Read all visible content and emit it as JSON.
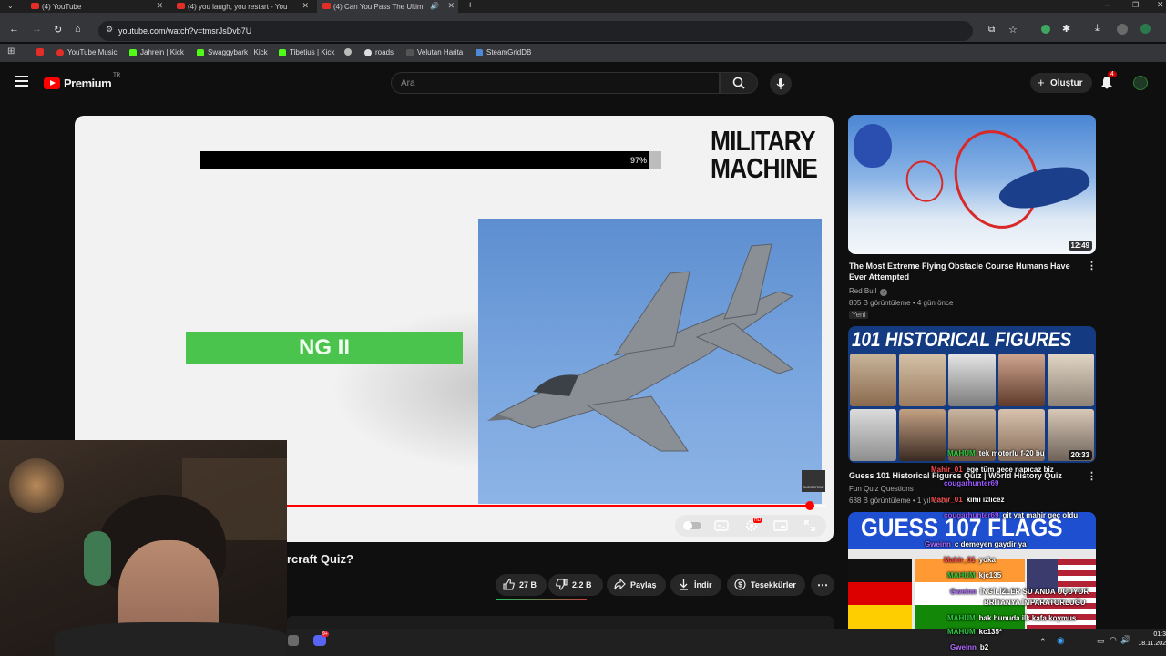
{
  "browser": {
    "tabs": [
      {
        "title": "(4) YouTube",
        "active": false
      },
      {
        "title": "(4) you laugh, you restart - You",
        "active": false
      },
      {
        "title": "(4) Can You Pass The Ultim",
        "active": true
      }
    ],
    "url": "youtube.com/watch?v=tmsrJsDvb7U",
    "bookmarks": [
      "YouTube Music",
      "Jahrein | Kick",
      "Swaggybark | Kick",
      "Tibetius | Kick",
      "roads",
      "Velutan Harita",
      "SteamGridDB"
    ]
  },
  "youtube": {
    "logo_text": "Premium",
    "logo_region": "TR",
    "search_placeholder": "Ara",
    "create_label": "Oluştur",
    "notification_count": "4"
  },
  "player": {
    "quiz_progress_label": "97%",
    "quiz_progress": 0.97,
    "category_line1": "MILITARY",
    "category_line2": "MACHINE",
    "answer_text": "NG II",
    "subscribe_label": "SUBSCRIBE",
    "hd_badge": "HD",
    "playback_progress": 0.97
  },
  "video": {
    "title_visible": "rcraft Quiz?",
    "actions": {
      "likes": "27 B",
      "dislikes": "2,2 B",
      "share": "Paylaş",
      "download": "İndir",
      "thanks": "Teşekkürler"
    }
  },
  "related": [
    {
      "title": "The Most Extreme Flying Obstacle Course Humans Have Ever Attempted",
      "channel": "Red Bull",
      "meta": "805 B görüntüleme • 4 gün önce",
      "badge": "Yeni",
      "duration": "12:49"
    },
    {
      "thumb_text": "101 HISTORICAL FIGURES",
      "title": "Guess 101 Historical Figures Quiz | World History Quiz",
      "channel": "Fun Quiz Questions",
      "meta": "688 B görüntüleme • 1 yıl önce",
      "duration": "20:33"
    },
    {
      "thumb_text": "GUESS 107 FLAGS"
    }
  ],
  "chat": [
    {
      "user": "MAHUM",
      "msg": "tek motorlu f-20 bu",
      "color": "#2ecc40"
    },
    {
      "user": "Mahir_01",
      "msg": "ege tüm gece napıcaz biz",
      "color": "#ff4d4d"
    },
    {
      "user": "cougarhunter69",
      "msg": "",
      "color": "#9b59ff"
    },
    {
      "user": "Mahir_01",
      "msg": "kimi izlicez",
      "color": "#ff4d4d"
    },
    {
      "user": "cougarhunter69",
      "msg": "git yat mahir geç oldu",
      "color": "#9b59ff"
    },
    {
      "user": "Gweinn",
      "msg": "c demeyen gaydir ya",
      "color": "#b06cff"
    },
    {
      "user": "Mahir_01",
      "msg": "yoka",
      "color": "#ff4d4d"
    },
    {
      "user": "MAHUM",
      "msg": "kjc135",
      "color": "#2ecc40"
    },
    {
      "user": "Gweinn",
      "msg": "İNGİLİZLER ŞU ANDA UÇUYOR",
      "color": "#b06cff"
    },
    {
      "user": "",
      "msg": "BRİTANYA İMPARATORLUĞU",
      "color": "#b06cff"
    },
    {
      "user": "MAHUM",
      "msg": "bak bunuda ilk kafa koymus",
      "color": "#2ecc40"
    },
    {
      "user": "MAHUM",
      "msg": "kc135*",
      "color": "#2ecc40"
    },
    {
      "user": "Gweinn",
      "msg": "b2",
      "color": "#b06cff"
    }
  ],
  "taskbar": {
    "time": "01:3",
    "date": "18.11.202"
  }
}
